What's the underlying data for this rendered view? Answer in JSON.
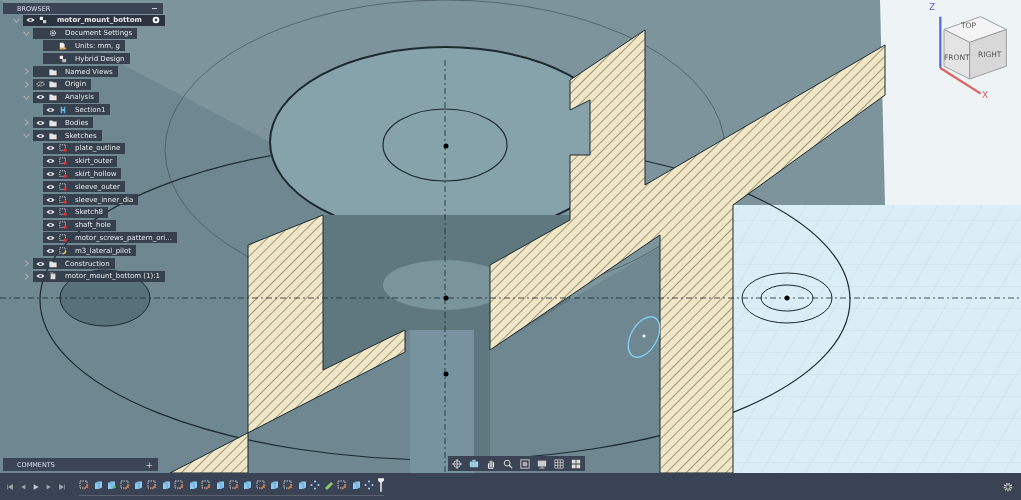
{
  "browser": {
    "title": "BROWSER",
    "tree": [
      {
        "label": "motor_mount_bottom",
        "kind": "component",
        "visible": true,
        "expanded": true,
        "active": true,
        "children": [
          {
            "label": "Document Settings",
            "kind": "gear",
            "expanded": true,
            "children": [
              {
                "label": "Units: mm, g",
                "kind": "units"
              },
              {
                "label": "Hybrid Design",
                "kind": "design"
              }
            ]
          },
          {
            "label": "Named Views",
            "kind": "folder",
            "expanded": false
          },
          {
            "label": "Origin",
            "kind": "folder",
            "visible": false,
            "expanded": false
          },
          {
            "label": "Analysis",
            "kind": "folder",
            "visible": true,
            "expanded": true,
            "children": [
              {
                "label": "Section1",
                "kind": "section",
                "visible": true
              }
            ]
          },
          {
            "label": "Bodies",
            "kind": "folder",
            "visible": true,
            "expanded": false
          },
          {
            "label": "Sketches",
            "kind": "folder",
            "visible": true,
            "expanded": true,
            "children": [
              {
                "label": "plate_outline",
                "kind": "sketch",
                "visible": true
              },
              {
                "label": "skirt_outer",
                "kind": "sketch",
                "visible": true
              },
              {
                "label": "skirt_hollow",
                "kind": "sketch",
                "visible": true
              },
              {
                "label": "sleeve_outer",
                "kind": "sketch",
                "visible": true
              },
              {
                "label": "sleeve_inner_dia",
                "kind": "sketch",
                "visible": true
              },
              {
                "label": "Sketch8",
                "kind": "sketch",
                "visible": true
              },
              {
                "label": "shaft_hole",
                "kind": "sketch",
                "visible": true
              },
              {
                "label": "motor_screws_pattern_ori...",
                "kind": "sketch",
                "visible": true
              },
              {
                "label": "m3_lateral_pilot",
                "kind": "sketch-edit",
                "visible": true
              }
            ]
          },
          {
            "label": "Construction",
            "kind": "folder",
            "visible": true,
            "expanded": false
          },
          {
            "label": "motor_mount_bottom (1):1",
            "kind": "component-link",
            "visible": true,
            "expanded": false
          }
        ]
      }
    ]
  },
  "viewcube": {
    "faces": [
      "TOP",
      "FRONT",
      "RIGHT"
    ],
    "axes": [
      "Z",
      "X"
    ]
  },
  "comments": {
    "title": "COMMENTS",
    "add": "+"
  },
  "timeline": [
    {
      "kind": "sketch"
    },
    {
      "kind": "extrude"
    },
    {
      "kind": "extrude-new"
    },
    {
      "kind": "sketch"
    },
    {
      "kind": "extrude"
    },
    {
      "kind": "sketch"
    },
    {
      "kind": "extrude"
    },
    {
      "kind": "sketch"
    },
    {
      "kind": "extrude"
    },
    {
      "kind": "sketch"
    },
    {
      "kind": "extrude"
    },
    {
      "kind": "sketch"
    },
    {
      "kind": "extrude"
    },
    {
      "kind": "sketch"
    },
    {
      "kind": "extrude"
    },
    {
      "kind": "sketch"
    },
    {
      "kind": "extrude"
    },
    {
      "kind": "pattern"
    },
    {
      "kind": "section"
    },
    {
      "kind": "sketch"
    },
    {
      "kind": "extrude"
    },
    {
      "kind": "pattern"
    }
  ]
}
